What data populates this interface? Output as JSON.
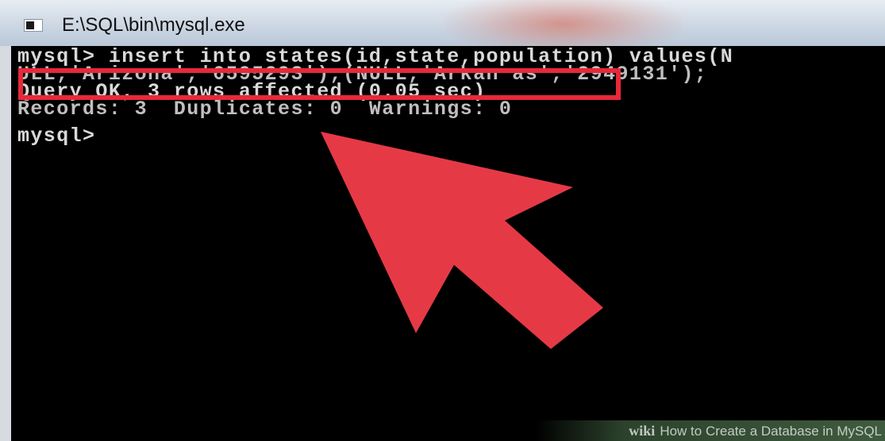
{
  "window": {
    "title": "E:\\SQL\\bin\\mysql.exe"
  },
  "console": {
    "lines": [
      "mysql> insert into states(id,state,population) values(N",
      "ULL,'Arizona','6595293'),(NULL,'Arkan as','2949131');",
      "Query OK, 3 rows affected (0.05 sec)",
      "Records: 3  Duplicates: 0  Warnings: 0",
      "mysql>"
    ]
  },
  "watermark": {
    "brand": "wiki",
    "text": "How to Create a Database in MySQL"
  },
  "colors": {
    "highlight": "#e8283a",
    "arrow": "#e63946",
    "console_bg": "#000000",
    "console_text": "#d9d9d9"
  }
}
